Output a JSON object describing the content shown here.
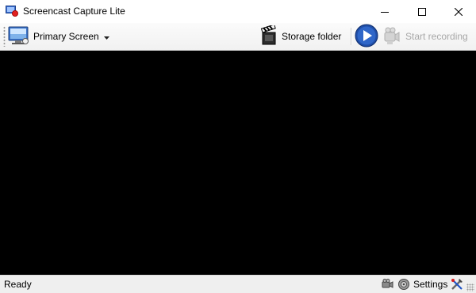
{
  "window": {
    "title": "Screencast Capture Lite"
  },
  "titlebar_icons": [
    "app-icon",
    "minimize-icon",
    "maximize-icon",
    "close-icon"
  ],
  "toolbar": {
    "screen_label": "Primary Screen",
    "storage_label": "Storage folder",
    "record_label": "Start recording",
    "icons": [
      "monitor-icon",
      "dropdown-arrow-icon",
      "clapperboard-icon",
      "play-icon",
      "camcorder-icon"
    ]
  },
  "main": {
    "background": "#000000"
  },
  "status": {
    "text": "Ready",
    "settings_label": "Settings",
    "icons": [
      "webcam-icon",
      "disc-icon",
      "tools-icon"
    ]
  },
  "colors": {
    "play_button": "#1f4ea8",
    "disabled_text": "#a8a8a8"
  }
}
